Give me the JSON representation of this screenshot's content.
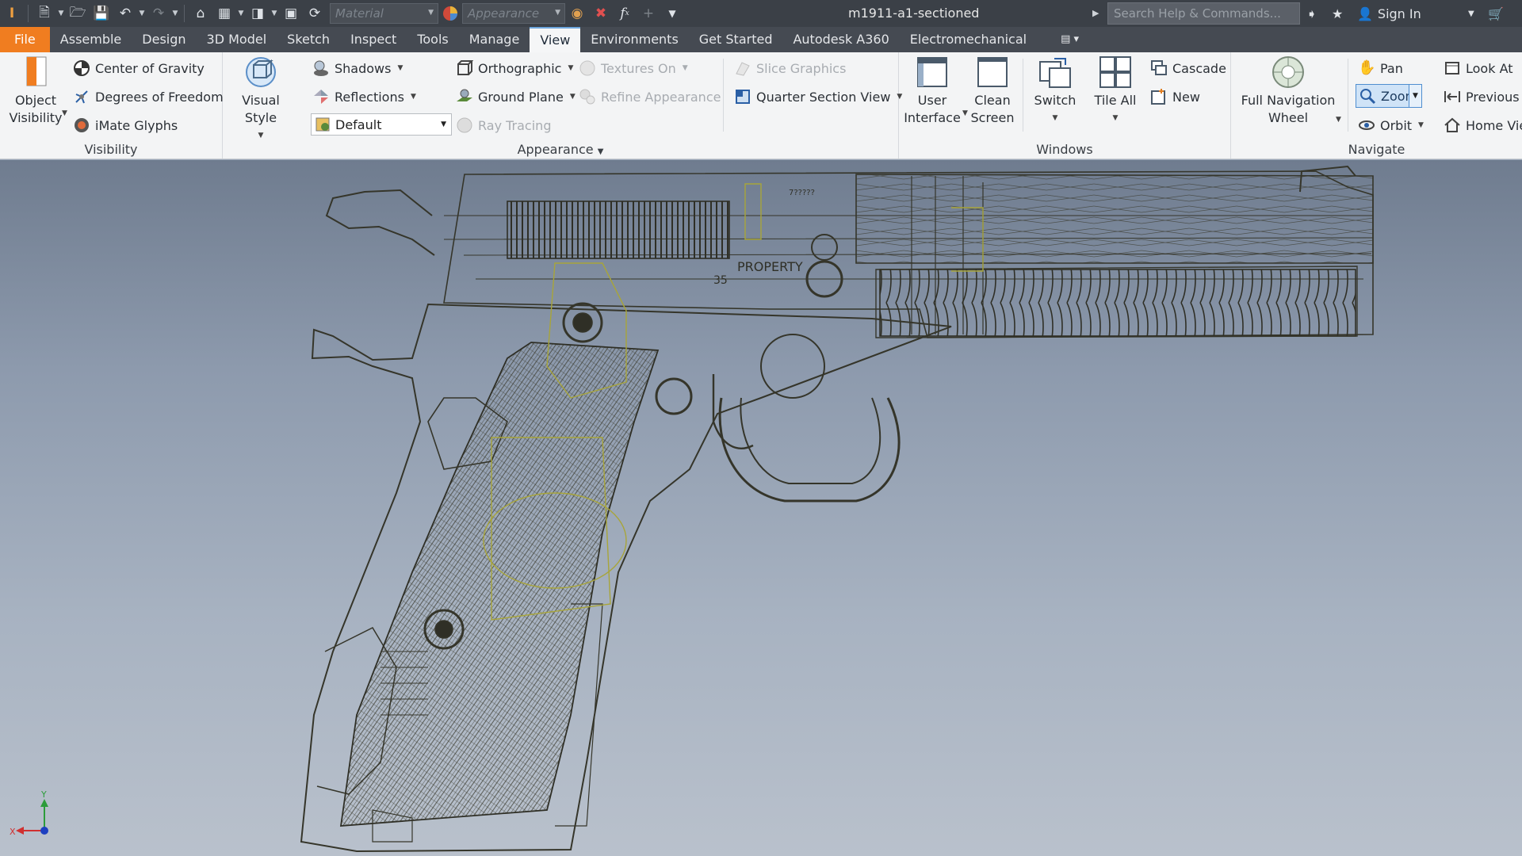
{
  "titlebar": {
    "document_title": "m1911-a1-sectioned",
    "material_placeholder": "Material",
    "appearance_placeholder": "Appearance",
    "search_placeholder": "Search Help & Commands...",
    "sign_in": "Sign In"
  },
  "tabs": [
    "File",
    "Assemble",
    "Design",
    "3D Model",
    "Sketch",
    "Inspect",
    "Tools",
    "Manage",
    "View",
    "Environments",
    "Get Started",
    "Autodesk A360",
    "Electromechanical"
  ],
  "active_tab": "View",
  "ribbon": {
    "visibility": {
      "label": "Visibility",
      "object_visibility_line1": "Object",
      "object_visibility_line2": "Visibility",
      "center_of_gravity": "Center of Gravity",
      "degrees_of_freedom": "Degrees of Freedom",
      "imate_glyphs": "iMate Glyphs"
    },
    "appearance": {
      "label": "Appearance",
      "visual_style": "Visual Style",
      "shadows": "Shadows",
      "reflections": "Reflections",
      "default_value": "Default",
      "orthographic": "Orthographic",
      "ground_plane": "Ground Plane",
      "ray_tracing": "Ray Tracing",
      "textures_on": "Textures On",
      "refine_appearance": "Refine Appearance",
      "slice_graphics": "Slice Graphics",
      "quarter_section_view": "Quarter Section View"
    },
    "windows": {
      "label": "Windows",
      "user_interface_line1": "User",
      "user_interface_line2": "Interface",
      "clean_screen_line1": "Clean",
      "clean_screen_line2": "Screen",
      "switch": "Switch",
      "tile_all": "Tile All",
      "cascade": "Cascade",
      "new": "New"
    },
    "navigate": {
      "label": "Navigate",
      "full_nav_line1": "Full Navigation",
      "full_nav_line2": "Wheel",
      "pan": "Pan",
      "zoom": "Zoom",
      "orbit": "Orbit",
      "look_at": "Look At",
      "previous": "Previous",
      "home_view": "Home Vie"
    }
  },
  "viewport": {
    "stamp_text_1": "PROPERTY",
    "stamp_text_2": "35",
    "serial": "7?????",
    "triad_x": "X",
    "triad_y": "Y"
  },
  "colors": {
    "file_tab": "#f07d20",
    "titlebar": "#3b4047",
    "tabbar": "#454a52",
    "ribbon": "#f3f4f5",
    "wire": "#3a3a2e",
    "wire_highlight": "#a8a53a",
    "zoom_active": "#cfe3f7"
  }
}
